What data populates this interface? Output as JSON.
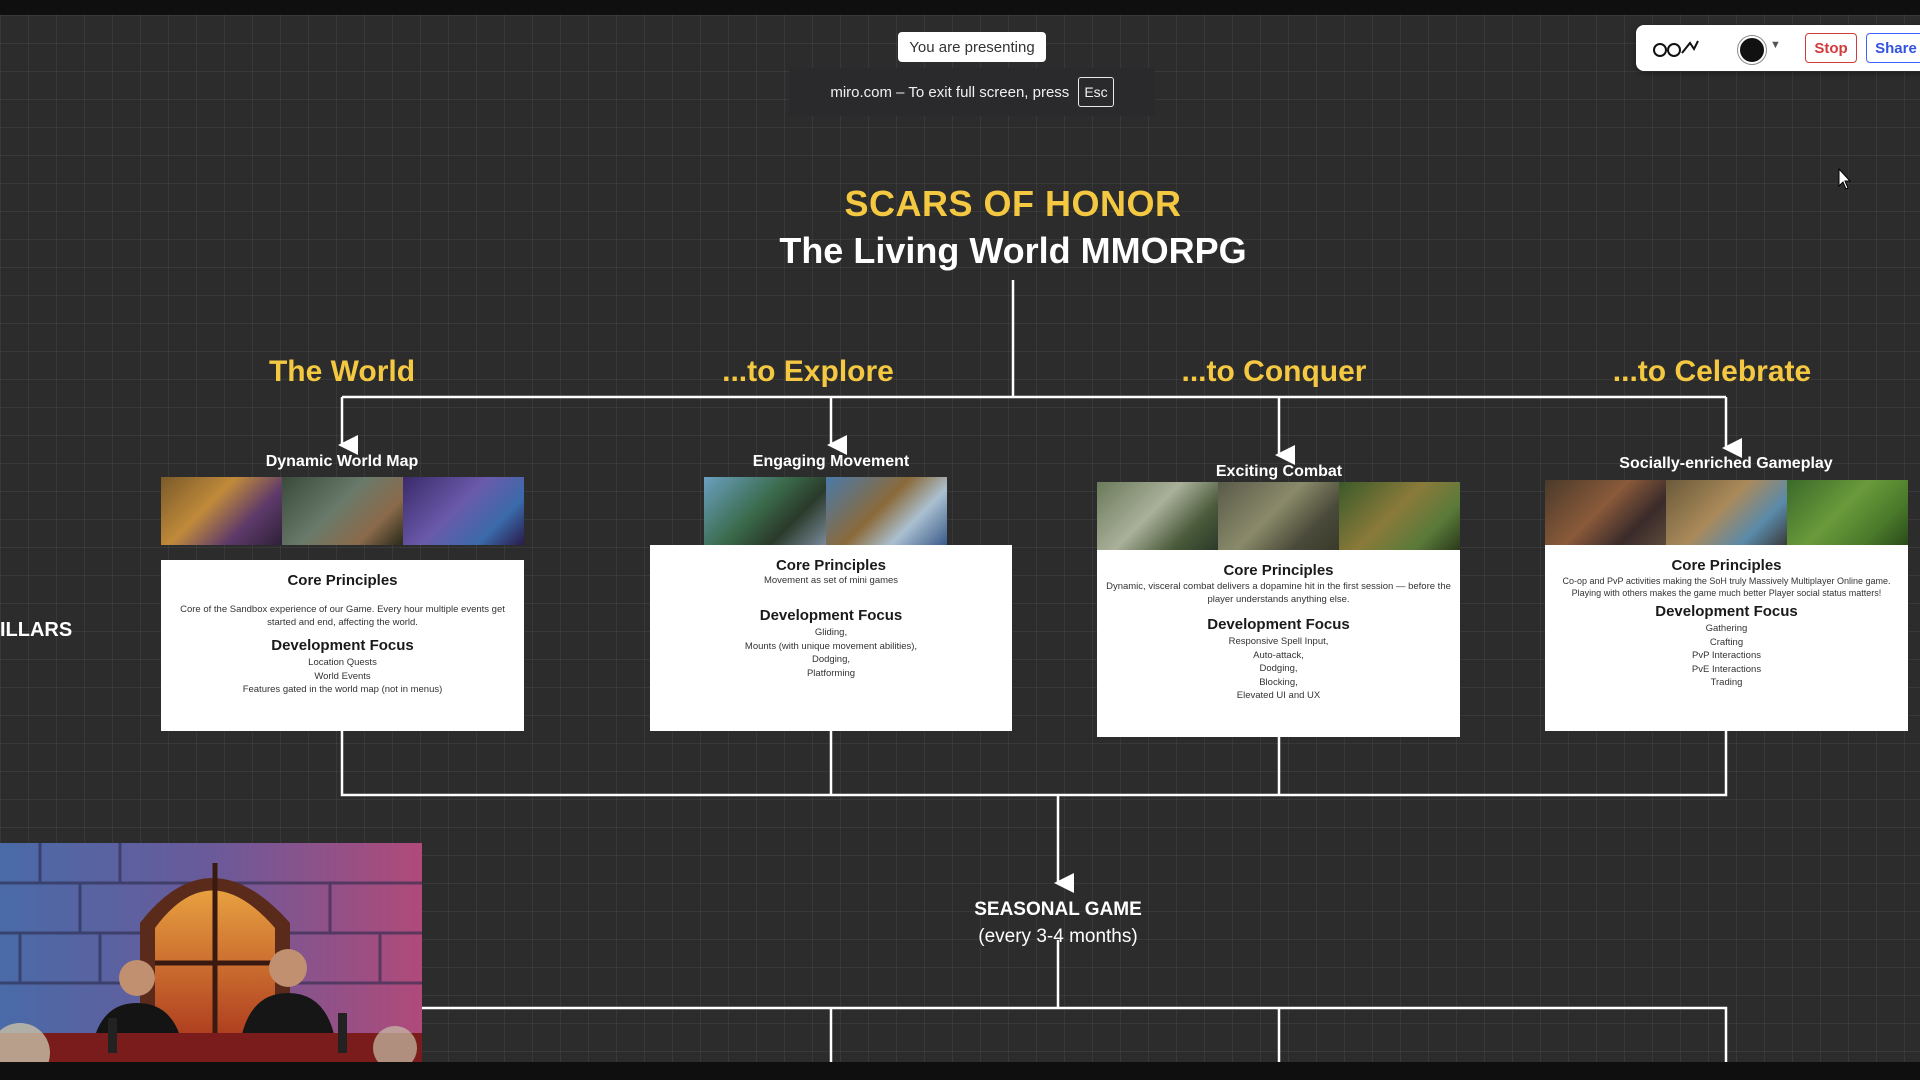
{
  "banner": {
    "presenting": "You are presenting",
    "fullscreen_msg": "miro.com – To exit full screen, press",
    "esc_key": "Esc"
  },
  "toolbar": {
    "presenters_icon": "presenters-icon",
    "avatar_icon": "user-avatar-icon",
    "stop_label": "Stop",
    "share_label": "Share"
  },
  "board": {
    "title": "SCARS OF HONOR",
    "subtitle": "The Living World MMORPG",
    "pillars_label": "ILLARS",
    "pillars": [
      {
        "name": "The World"
      },
      {
        "name": "...to Explore"
      },
      {
        "name": "...to Conquer"
      },
      {
        "name": "...to Celebrate"
      }
    ],
    "cards": [
      {
        "title": "Dynamic World Map",
        "core_heading": "Core Principles",
        "core_text": "Core of the Sandbox experience of our Game. Every hour multiple events get started and end, affecting the world.",
        "dev_heading": "Development Focus",
        "dev_items": [
          "Location Quests",
          "World Events",
          "Features gated in the world map (not in menus)"
        ]
      },
      {
        "title": "Engaging Movement",
        "core_heading": "Core Principles",
        "core_text": "Movement as set of mini games",
        "dev_heading": "Development Focus",
        "dev_items": [
          "Gliding,",
          "Mounts (with unique movement abilities),",
          "Dodging,",
          "Platforming"
        ]
      },
      {
        "title": "Exciting Combat",
        "core_heading": "Core Principles",
        "core_text": "Dynamic, visceral combat delivers a dopamine hit in the first session — before the player understands anything else.",
        "dev_heading": "Development Focus",
        "dev_items": [
          "Responsive Spell Input,",
          "Auto-attack,",
          "Dodging,",
          "Blocking,",
          "Elevated UI and UX"
        ]
      },
      {
        "title": "Socially-enriched Gameplay",
        "core_heading": "Core Principles",
        "core_text": "Co-op and PvP activities making the SoH truly Massively Multiplayer Online game. Playing with others makes the game much better Player social status matters!",
        "dev_heading": "Development Focus",
        "dev_items": [
          "Gathering",
          "Crafting",
          "PvP Interactions",
          "PvE Interactions",
          "Trading"
        ]
      }
    ],
    "seasonal_title": "SEASONAL GAME",
    "seasonal_sub": "(every 3-4 months)"
  },
  "colors": {
    "canvas": "#2b2c2b",
    "gold": "#f5c842",
    "stop": "#d23b3b",
    "share": "#4262ff"
  }
}
